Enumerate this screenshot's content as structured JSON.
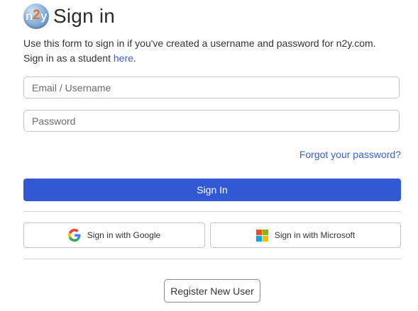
{
  "header": {
    "logo": {
      "letters": [
        "n",
        "2",
        "y"
      ],
      "alt": "n2y logo"
    },
    "title": "Sign in"
  },
  "intro": {
    "text_before": "Use this form to sign in if you've created a username and password for n2y.com. Sign in as a student ",
    "link_text": "here",
    "text_after": "."
  },
  "form": {
    "email_placeholder": "Email / Username",
    "password_placeholder": "Password",
    "forgot_label": "Forgot your password?",
    "submit_label": "Sign In"
  },
  "social": {
    "google_label": "Sign in with Google",
    "microsoft_label": "Sign in with Microsoft"
  },
  "footer": {
    "register_label": "Register New User"
  },
  "colors": {
    "primary": "#3358d4",
    "link": "#3b5fd1",
    "border": "#c4c4c4"
  }
}
